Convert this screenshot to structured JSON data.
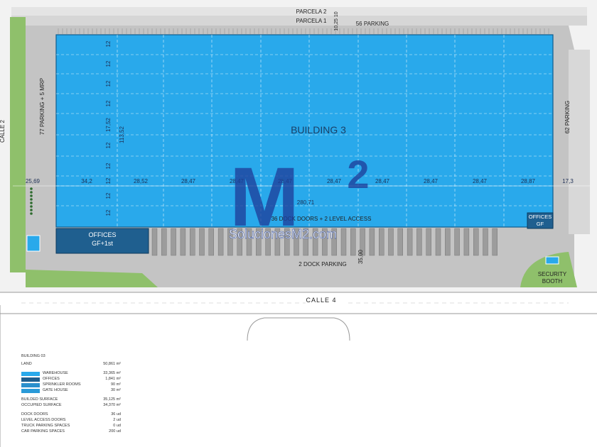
{
  "plan": {
    "parcela2": "PARCELA 2",
    "parcela1": "PARCELA 1",
    "top_dims": "10,25 10",
    "parking_top": "56 PARKING",
    "parking_left": "77 PARKING + 5 MRP",
    "parking_right": "62 PARKING",
    "street_left": "CALLE 2",
    "street_bottom": "CALLE 4",
    "building": "BUILDING 3",
    "row_dims": [
      "12",
      "12",
      "12",
      "12",
      "17,52",
      "12",
      "12",
      "12",
      "12",
      "12",
      "17,52"
    ],
    "depth_dim": "113,52",
    "bay_dims": [
      "25,69",
      "34,2",
      "28,52",
      "28,47",
      "28,47",
      "28,47",
      "28,47",
      "28,47",
      "28,47",
      "28,47",
      "28,87",
      "17,3"
    ],
    "length_dim": "280,71",
    "docks_text": "36 DOCK DOORS + 2 LEVEL ACCESS",
    "offices_left_1": "OFFICES",
    "offices_left_2": "GF+1st",
    "offices_right_1": "OFFICES",
    "offices_right_2": "GF",
    "dock_parking": "2 DOCK PARKING",
    "yard_dim": "35,00",
    "security_1": "SECURITY",
    "security_2": "BOOTH",
    "watermark_brand": "M",
    "watermark_sup": "2",
    "watermark_text": "SolucionesM2.com"
  },
  "colors": {
    "warehouse": "#29a9eb",
    "offices": "#1f5f8f",
    "sprinkler": "#2a8fcc",
    "gatehouse": "#2a9ad8",
    "green": "#8fc06b",
    "asphalt": "#c4c4c4"
  },
  "legend": {
    "title": "BUILDING 03",
    "land_label": "LAND",
    "land_value": "50,861 m²",
    "items": [
      {
        "label": "WAREHOUSE",
        "value": "33,365 m²"
      },
      {
        "label": "OFFICES",
        "value": "1,841 m²"
      },
      {
        "label": "SPRINKLER ROOMS",
        "value": "90 m²"
      },
      {
        "label": "GATE HOUSE",
        "value": "30 m²"
      }
    ],
    "built_label": "BUILDED SURFACE",
    "built_value": "35,125 m²",
    "occupied_label": "OCCUPIED SURFACE",
    "occupied_value": "34,370 m²",
    "counts": [
      {
        "label": "DOCK DOORS",
        "value": "36 ud"
      },
      {
        "label": "LEVEL ACCESS DOORS",
        "value": "2 ud"
      },
      {
        "label": "TRUCK PARKING SPACES",
        "value": "0 ud"
      },
      {
        "label": "CAR PARKING SPACES",
        "value": "200 ud"
      }
    ]
  }
}
